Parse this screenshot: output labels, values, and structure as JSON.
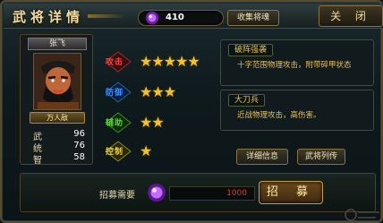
{
  "header": {
    "title": "武将详情",
    "gems": "410",
    "collect_label": "收集将魂",
    "close_label": "关 闭"
  },
  "general": {
    "name": "张飞",
    "title": "万人敌",
    "stats": [
      {
        "label": "武",
        "value": "96"
      },
      {
        "label": "统",
        "value": "76"
      },
      {
        "label": "智",
        "value": "58"
      }
    ]
  },
  "skills": [
    {
      "name": "攻击",
      "stars": 5,
      "color": "#ff4040"
    },
    {
      "name": "防御",
      "stars": 3,
      "color": "#3a8dff"
    },
    {
      "name": "辅助",
      "stars": 2,
      "color": "#5fd13a"
    },
    {
      "name": "控制",
      "stars": 1,
      "color": "#e6d23a"
    }
  ],
  "descriptions": [
    {
      "title": "破阵强袭",
      "text": "十字范围物理攻击，附带碎甲状态"
    },
    {
      "title": "大刀兵",
      "text": "近战物理攻击，高伤害。"
    }
  ],
  "buttons": {
    "detail_label": "详细信息",
    "bio_label": "武将列传",
    "recruit_label": "招 募"
  },
  "recruit": {
    "label": "招募需要",
    "cost": "1000"
  },
  "colors": {
    "gold": "#f2dca0",
    "gem_purple": "#9b3bd6",
    "cost_red": "#e23a2a",
    "star": "#f4c12a"
  }
}
